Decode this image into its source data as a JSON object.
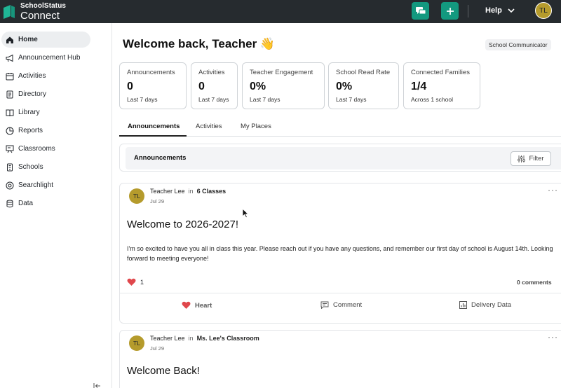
{
  "brand": {
    "top": "SchoolStatus",
    "bottom": "Connect"
  },
  "topbar": {
    "help_label": "Help",
    "user_initials": "TL"
  },
  "sidebar": {
    "items": [
      {
        "label": "Home",
        "icon": "home-icon"
      },
      {
        "label": "Announcement Hub",
        "icon": "megaphone-icon"
      },
      {
        "label": "Activities",
        "icon": "calendar-icon"
      },
      {
        "label": "Directory",
        "icon": "directory-icon"
      },
      {
        "label": "Library",
        "icon": "book-icon"
      },
      {
        "label": "Reports",
        "icon": "pie-chart-icon"
      },
      {
        "label": "Classrooms",
        "icon": "classroom-icon"
      },
      {
        "label": "Schools",
        "icon": "school-icon"
      },
      {
        "label": "Searchlight",
        "icon": "searchlight-icon"
      },
      {
        "label": "Data",
        "icon": "database-icon"
      }
    ]
  },
  "main": {
    "welcome": "Welcome back, Teacher 👋",
    "role": "School Communicator",
    "stats": [
      {
        "title": "Announcements",
        "value": "0",
        "sub": "Last 7 days"
      },
      {
        "title": "Activities",
        "value": "0",
        "sub": "Last 7 days"
      },
      {
        "title": "Teacher Engagement",
        "value": "0%",
        "sub": "Last 7 days"
      },
      {
        "title": "School Read Rate",
        "value": "0%",
        "sub": "Last 7 days"
      },
      {
        "title": "Connected Families",
        "value": "1/4",
        "sub": "Across 1 school"
      }
    ],
    "tabs": [
      "Announcements",
      "Activities",
      "My Places"
    ],
    "panel_title": "Announcements",
    "filter_label": "Filter"
  },
  "posts": [
    {
      "initials": "TL",
      "author": "Teacher Lee",
      "in_label": "in",
      "audience": "6 Classes",
      "date": "Jul 29",
      "title": "Welcome to 2026-2027!",
      "body": "I'm so excited to have you all in class this year. Please reach out if you have any questions, and remember our first day of school is August 14th. Looking forward to meeting everyone!",
      "heart_count": "1",
      "comments": "0 comments",
      "actions": {
        "heart": "Heart",
        "comment": "Comment",
        "delivery": "Delivery Data"
      }
    },
    {
      "initials": "TL",
      "author": "Teacher Lee",
      "in_label": "in",
      "audience": "Ms. Lee's Classroom",
      "date": "Jul 29",
      "title": "Welcome Back!"
    }
  ],
  "colors": {
    "accent": "#13997f",
    "topbar": "#262b2f",
    "avatar": "#b59b2c",
    "heart": "#e0474c"
  }
}
